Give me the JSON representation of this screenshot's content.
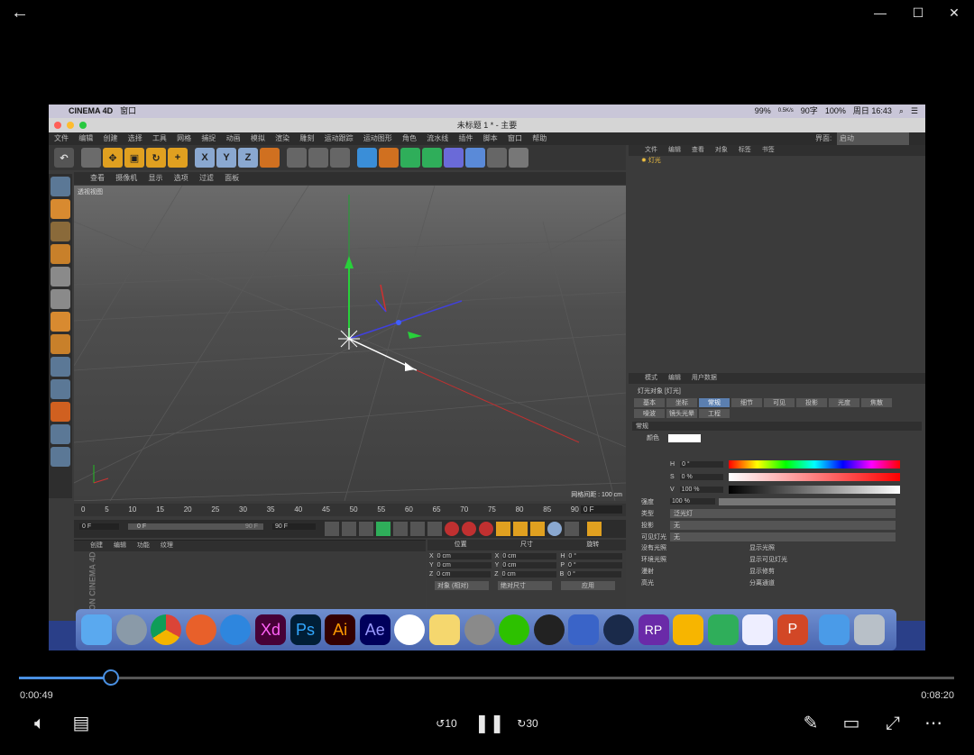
{
  "player": {
    "back_icon": "arrow-left-icon",
    "window_controls": {
      "minimize": "—",
      "maximize": "☐",
      "close": "✕"
    },
    "current_time": "0:00:49",
    "total_time": "0:08:20",
    "progress": 0.098,
    "controls": {
      "volume_icon": "speaker-icon",
      "captions_icon": "captions-icon",
      "rewind_label": "10",
      "play_pause_icon": "pause-icon",
      "forward_label": "30",
      "pen_icon": "pen-icon",
      "miniplayer_icon": "miniplayer-icon",
      "fullscreen_icon": "expand-icon",
      "more_label": "⋯"
    }
  },
  "video": {
    "mac_menubar": {
      "app": "CINEMA 4D",
      "menu": "窗口",
      "battery": "99%",
      "net_speed": "0.5K/s",
      "char_count": "90字",
      "wifi_pct": "100%",
      "datetime": "周日 16:43"
    },
    "c4d": {
      "title": "未标题 1 * - 主要",
      "menu": [
        "文件",
        "编辑",
        "创建",
        "选择",
        "工具",
        "网格",
        "捕捉",
        "动画",
        "模拟",
        "渲染",
        "雕刻",
        "运动跟踪",
        "运动图形",
        "角色",
        "流水线",
        "插件",
        "脚本",
        "窗口",
        "帮助"
      ],
      "interface_label": "界面:",
      "interface_value": "启动",
      "viewport_menu": [
        "查看",
        "摄像机",
        "显示",
        "选项",
        "过滤",
        "面板"
      ],
      "viewport_name": "透视视图",
      "grid_spacing": "网格间距 : 100 cm",
      "timeline_ticks": [
        "0",
        "5",
        "10",
        "15",
        "20",
        "25",
        "30",
        "35",
        "40",
        "45",
        "50",
        "55",
        "60",
        "65",
        "70",
        "75",
        "80",
        "85",
        "90"
      ],
      "frame_end": "0 F",
      "play_start": "0 F",
      "play_slider": "0 F",
      "play_slider_end": "90 F",
      "play_end": "90 F",
      "material_menu": [
        "创建",
        "编辑",
        "功能",
        "纹理"
      ],
      "coords": {
        "headers": [
          "位置",
          "尺寸",
          "旋转"
        ],
        "rows": [
          {
            "a": "X",
            "v1": "0 cm",
            "b": "X",
            "v2": "0 cm",
            "c": "H",
            "v3": "0 °"
          },
          {
            "a": "Y",
            "v1": "0 cm",
            "b": "Y",
            "v2": "0 cm",
            "c": "P",
            "v3": "0 °"
          },
          {
            "a": "Z",
            "v1": "0 cm",
            "b": "Z",
            "v2": "0 cm",
            "c": "B",
            "v3": "0 °"
          }
        ],
        "mode1": "对象 (相对)",
        "mode2": "绝对尺寸",
        "apply": "应用"
      },
      "object_menu": [
        "文件",
        "编辑",
        "查看",
        "对象",
        "标签",
        "书签"
      ],
      "object_item": "灯光",
      "attr_menu": [
        "模式",
        "编辑",
        "用户数据"
      ],
      "attr_title": "灯光对象 [灯光]",
      "attr_tabs_row1": [
        "基本",
        "坐标",
        "常规",
        "细节",
        "可见",
        "投影",
        "光度",
        "焦散"
      ],
      "attr_tabs_row2": [
        "噪波",
        "镜头光晕",
        "工程"
      ],
      "section": "常规",
      "color_label": "颜色",
      "hsv": [
        {
          "k": "H",
          "v": "0 °"
        },
        {
          "k": "S",
          "v": "0 %"
        },
        {
          "k": "V",
          "v": "100 %"
        }
      ],
      "props": [
        {
          "k": "强度",
          "v": "100 %"
        },
        {
          "k": "类型",
          "v": "泛光灯"
        },
        {
          "k": "投影",
          "v": "无"
        },
        {
          "k": "可见灯光",
          "v": "无"
        }
      ],
      "checks_left": [
        "没有光照",
        "环境光照",
        "漫射",
        "高光"
      ],
      "checks_right": [
        "显示光照",
        "显示可见灯光",
        "显示修剪",
        "分离通道"
      ],
      "brand": "MAXON CINEMA 4D",
      "toolbar_axes": [
        "X",
        "Y",
        "Z"
      ]
    },
    "dock_icons": [
      "finder-icon",
      "launchpad-icon",
      "chrome-icon",
      "firefox-icon",
      "safari-icon",
      "xd-icon",
      "ps-icon",
      "ai-icon",
      "ae-icon",
      "bilibili-icon",
      "notes-icon",
      "system-prefs-icon",
      "wechat-icon",
      "qq-icon",
      "vpn-shield-icon",
      "cinema4d-icon",
      "rp-icon",
      "sketch-icon",
      "camtasia-icon",
      "baidu-netdisk-icon",
      "powerpoint-icon",
      "downloads-folder-icon",
      "trash-icon"
    ],
    "dock_labels": {
      "xd": "Xd",
      "ps": "Ps",
      "ai": "Ai",
      "ae": "Ae",
      "rp": "RP",
      "ppt": "P"
    }
  },
  "colors": {
    "accent": "#4a90e2",
    "dock": "#5a78c4"
  }
}
